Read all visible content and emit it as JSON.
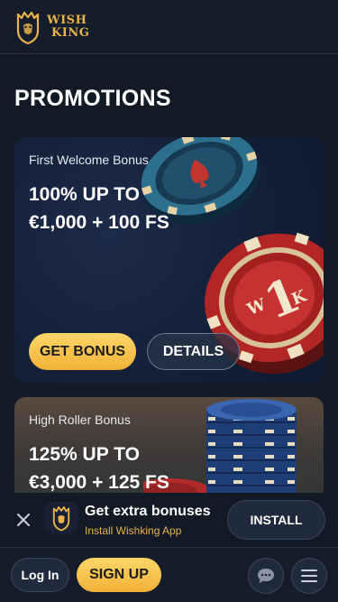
{
  "header": {
    "logo_line1": "WISH",
    "logo_line2": "KING"
  },
  "page": {
    "title": "PROMOTIONS"
  },
  "promotions": [
    {
      "subtitle": "First Welcome Bonus",
      "headline_line1": "100% UP TO",
      "headline_line2": "€1,000 + 100 FS",
      "primary_button": "GET BONUS",
      "secondary_button": "DETAILS",
      "chip_letters": [
        "W",
        "1",
        "K"
      ]
    },
    {
      "subtitle": "High Roller Bonus",
      "headline_line1": "125% UP TO",
      "headline_line2": "€3,000 + 125 FS"
    }
  ],
  "install_banner": {
    "title": "Get extra bonuses",
    "subtitle": "Install Wishking App",
    "button": "INSTALL",
    "close_icon": "close-icon",
    "app_icon": "lion-icon"
  },
  "bottom_bar": {
    "login": "Log In",
    "signup": "SIGN UP",
    "chat_icon": "chat-icon",
    "menu_icon": "menu-icon"
  },
  "colors": {
    "background": "#121a26",
    "accent_gold": "#f2b136",
    "brand_gold": "#e9b24a"
  }
}
